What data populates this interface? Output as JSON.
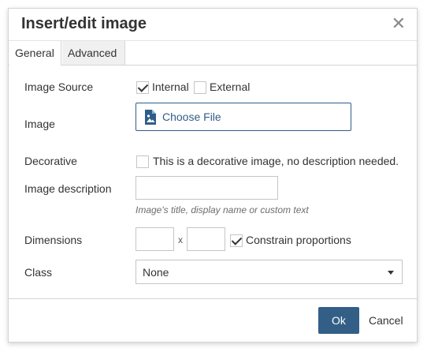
{
  "dialog": {
    "title": "Insert/edit image",
    "close_icon": "close-icon"
  },
  "tabs": [
    {
      "label": "General",
      "active": true
    },
    {
      "label": "Advanced",
      "active": false
    }
  ],
  "form": {
    "image_source": {
      "label": "Image Source",
      "internal_label": "Internal",
      "internal_checked": true,
      "external_label": "External",
      "external_checked": false
    },
    "image": {
      "label": "Image",
      "button_label": "Choose File",
      "icon": "image-file-icon"
    },
    "decorative": {
      "label": "Decorative",
      "checkbox_label": "This is a decorative image, no description needed.",
      "checked": false
    },
    "description": {
      "label": "Image description",
      "value": "",
      "help": "Image's title, display name or custom text"
    },
    "dimensions": {
      "label": "Dimensions",
      "width": "",
      "height": "",
      "separator": "x",
      "constrain_label": "Constrain proportions",
      "constrain_checked": true
    },
    "class": {
      "label": "Class",
      "selected": "None"
    }
  },
  "footer": {
    "ok_label": "Ok",
    "cancel_label": "Cancel"
  },
  "colors": {
    "primary": "#335f87",
    "link": "#2f5d8a"
  }
}
